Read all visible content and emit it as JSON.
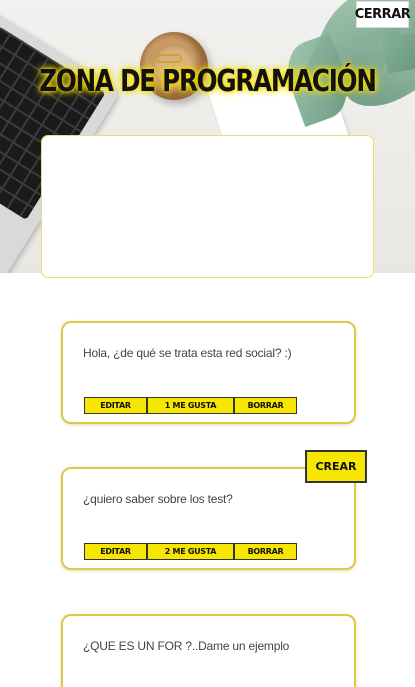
{
  "header": {
    "title": "ZONA DE PROGRAMACIÓN",
    "close_label": "CERRAR"
  },
  "compose": {
    "value": "",
    "create_label": "CREAR"
  },
  "posts": [
    {
      "text": "Hola, ¿de qué se trata esta red social? :)",
      "edit_label": "EDITAR",
      "like_label": "1 ME GUSTA",
      "delete_label": "BORRAR"
    },
    {
      "text": "¿quiero saber sobre los test?",
      "edit_label": "EDITAR",
      "like_label": "2 ME GUSTA",
      "delete_label": "BORRAR"
    },
    {
      "text": "¿QUE ES UN FOR ?..Dame un ejemplo"
    }
  ],
  "colors": {
    "accent": "#f6e600",
    "card_border": "#ddc84a"
  },
  "icons": [
    "laptop-image",
    "bowl-image",
    "plant-image"
  ]
}
